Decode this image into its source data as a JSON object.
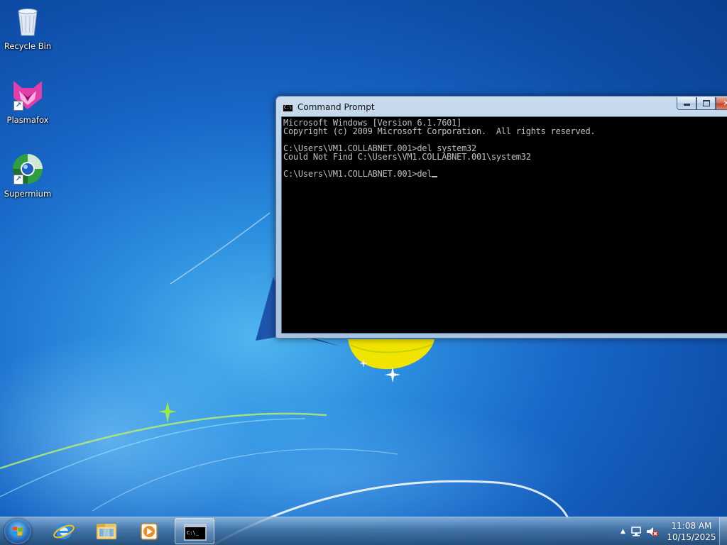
{
  "desktop": {
    "icons": [
      {
        "label": "Recycle Bin",
        "icon": "recycle-bin-icon"
      },
      {
        "label": "Plasmafox",
        "icon": "plasmafox-icon"
      },
      {
        "label": "Supermium",
        "icon": "supermium-icon"
      }
    ]
  },
  "cmd_window": {
    "title": "Command Prompt",
    "lines": [
      "Microsoft Windows [Version 6.1.7601]",
      "Copyright (c) 2009 Microsoft Corporation.  All rights reserved.",
      "",
      "C:\\Users\\VM1.COLLABNET.001>del system32",
      "Could Not Find C:\\Users\\VM1.COLLABNET.001\\system32",
      "",
      "C:\\Users\\VM1.COLLABNET.001>del"
    ],
    "controls": {
      "minimize": "minimize-icon",
      "maximize": "maximize-icon",
      "close": "close-icon"
    }
  },
  "taskbar": {
    "start": "windows-start-icon",
    "pinned": [
      {
        "name": "internet-explorer-icon"
      },
      {
        "name": "windows-explorer-icon"
      },
      {
        "name": "media-player-icon"
      },
      {
        "name": "command-prompt-icon",
        "active": true
      }
    ],
    "tray": {
      "icons": [
        "show-hidden-icons-icon",
        "network-icon",
        "volume-muted-icon"
      ],
      "time": "11:08 AM",
      "date": "10/15/2025"
    }
  },
  "colors": {
    "console_bg": "#000000",
    "console_text": "#C0C0C0",
    "wallpaper_blue": "#1866C6"
  }
}
